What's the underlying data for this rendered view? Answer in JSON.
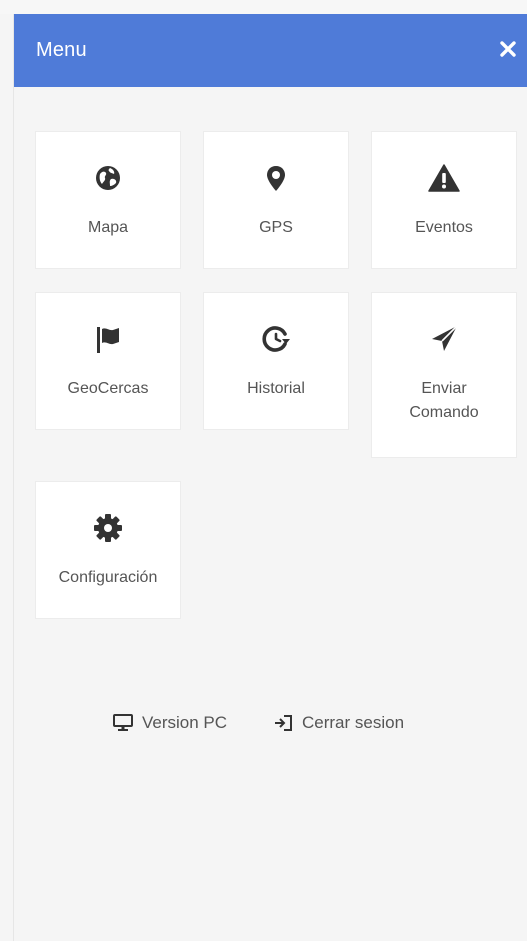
{
  "header": {
    "title": "Menu",
    "close_icon": "close-icon",
    "background": "#4f7bd8"
  },
  "menu": {
    "items": [
      {
        "label": "Mapa",
        "icon": "globe-icon"
      },
      {
        "label": "GPS",
        "icon": "map-pin-icon"
      },
      {
        "label": "Eventos",
        "icon": "warning-icon"
      },
      {
        "label": "GeoCercas",
        "icon": "flag-icon"
      },
      {
        "label": "Historial",
        "icon": "history-icon"
      },
      {
        "label": "Enviar\nComando",
        "icon": "send-icon"
      },
      {
        "label": "Configuración",
        "icon": "gear-icon"
      }
    ]
  },
  "footer": {
    "version_pc": {
      "label": "Version PC",
      "icon": "monitor-icon"
    },
    "logout": {
      "label": "Cerrar sesion",
      "icon": "sign-out-icon"
    }
  },
  "colors": {
    "accent": "#4f7bd8",
    "icon": "#333333",
    "text": "#555555",
    "panel": "#f5f5f5",
    "tile": "#ffffff"
  }
}
